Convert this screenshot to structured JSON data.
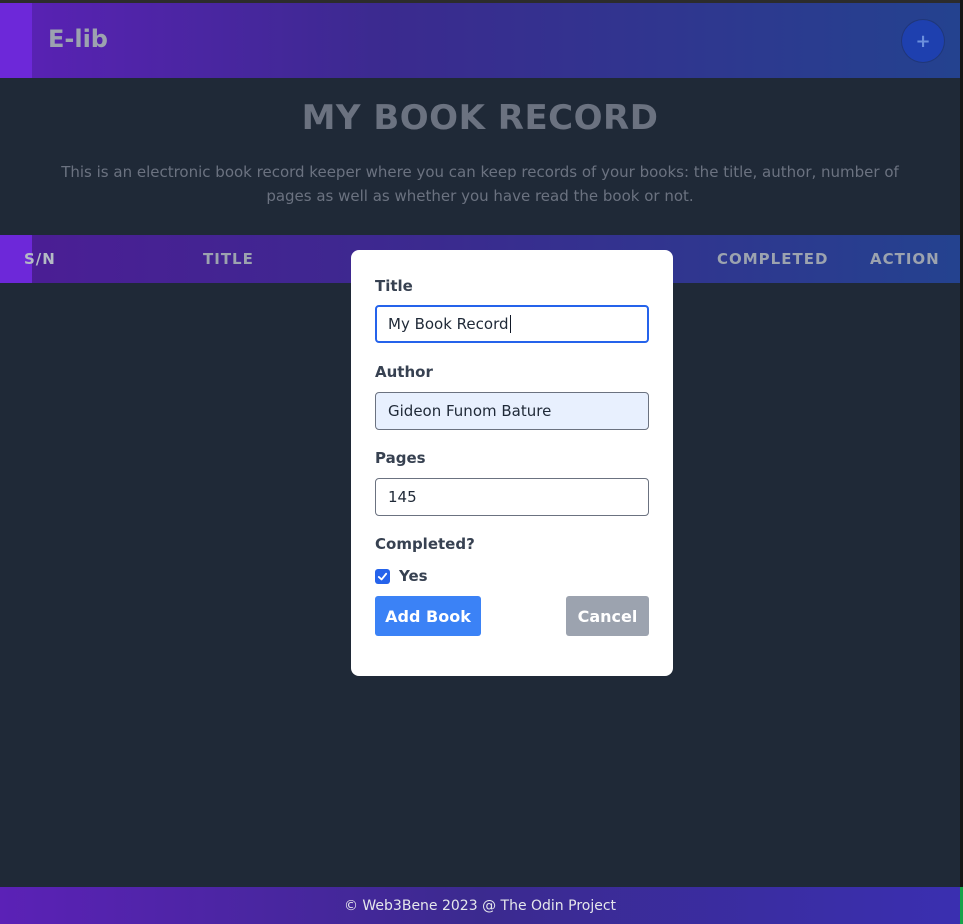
{
  "header": {
    "brand": "E-lib",
    "add_label": "+"
  },
  "hero": {
    "title": "MY BOOK RECORD",
    "description": "This is an electronic book record keeper where you can keep records of your books: the title, author, number of pages as well as whether you have read the book or not."
  },
  "table": {
    "columns": {
      "sn": "S/N",
      "title": "TITLE",
      "completed": "COMPLETED",
      "action": "ACTION"
    }
  },
  "modal": {
    "title_label": "Title",
    "title_value": "My Book Record",
    "author_label": "Author",
    "author_value": "Gideon Funom Bature",
    "pages_label": "Pages",
    "pages_value": "145",
    "completed_label": "Completed?",
    "completed_option": "Yes",
    "completed_checked": true,
    "add_button": "Add Book",
    "cancel_button": "Cancel"
  },
  "footer": {
    "text": "© Web3Bene 2023 @ The Odin Project"
  },
  "colors": {
    "background": "#1f2937",
    "accent_purple": "#6d28d9",
    "primary_button": "#3b82f6",
    "secondary_button": "#9ca3af",
    "focus_border": "#2563eb"
  },
  "icons": {
    "add": "plus-icon",
    "checkbox": "checkmark-icon"
  }
}
